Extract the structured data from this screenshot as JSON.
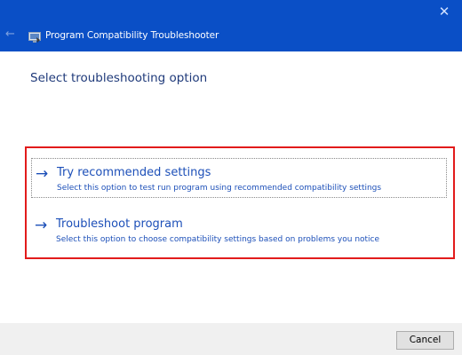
{
  "window": {
    "title": "Program Compatibility Troubleshooter",
    "close_glyph": "✕",
    "back_glyph": "←"
  },
  "heading": "Select troubleshooting option",
  "options": [
    {
      "arrow": "→",
      "title": "Try recommended settings",
      "description": "Select this option to test run program using recommended compatibility settings",
      "selected": true
    },
    {
      "arrow": "→",
      "title": "Troubleshoot program",
      "description": "Select this option to choose compatibility settings based on problems you notice",
      "selected": false
    }
  ],
  "footer": {
    "cancel_label": "Cancel"
  },
  "colors": {
    "titlebar": "#0a4fc6",
    "link": "#1c4fb8",
    "heading": "#1f3a7a",
    "highlight": "#e21b1b"
  },
  "icons": {
    "close": "close-icon",
    "back": "back-arrow-icon",
    "app": "troubleshooter-app-icon",
    "option_arrow": "arrow-right-icon"
  }
}
